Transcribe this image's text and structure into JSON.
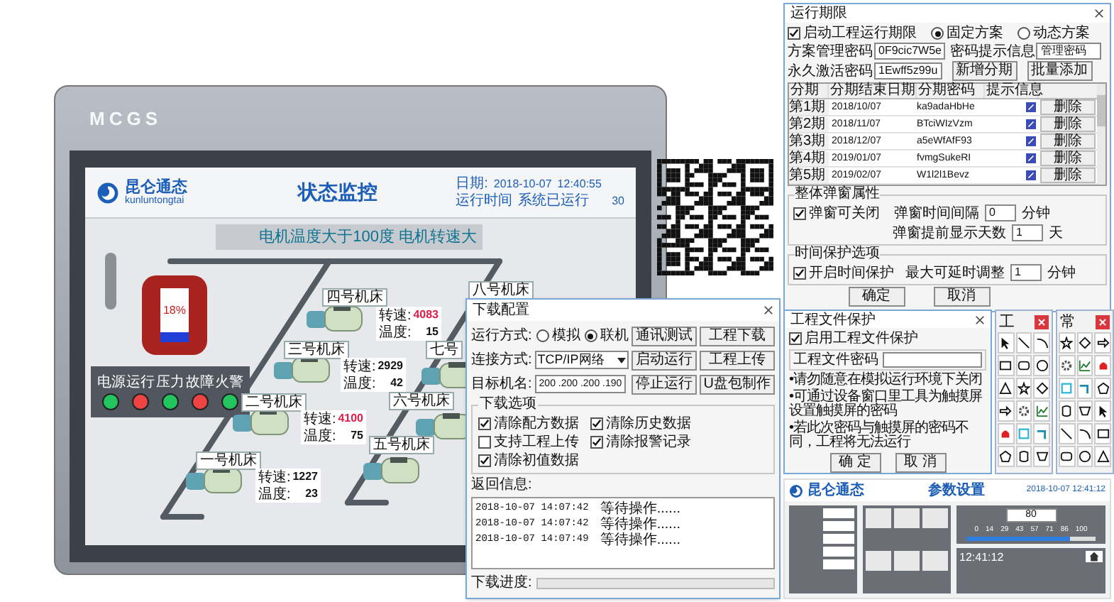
{
  "device": {
    "brand": "MCGS"
  },
  "hmi": {
    "logo": "昆仑通态",
    "logo_sub": "kunluntongtai",
    "title": "状态监控",
    "date_label": "日期:",
    "date": "2018-10-07",
    "time": "12:40:55",
    "runtime_label": "运行时间",
    "runtime_status": "系统已运行",
    "runtime_value": "30",
    "banner": "电机温度大于100度 电机转速大",
    "tank": {
      "reading": "18%",
      "level": 0.18
    },
    "indicators": [
      {
        "label": "电源",
        "color": "#22c55e"
      },
      {
        "label": "运行",
        "color": "#ef4444"
      },
      {
        "label": "压力",
        "color": "#22c55e"
      },
      {
        "label": "故障",
        "color": "#ef4444"
      },
      {
        "label": "火警",
        "color": "#22c55e"
      }
    ],
    "machines": [
      {
        "name": "四号机床",
        "speed_label": "转速:",
        "speed": "4083",
        "alarm": true,
        "temp_label": "温度:",
        "temp": "15"
      },
      {
        "name": "三号机床",
        "speed_label": "转速:",
        "speed": "2929",
        "alarm": false,
        "temp_label": "温度:",
        "temp": "42"
      },
      {
        "name": "二号机床",
        "speed_label": "转速:",
        "speed": "4100",
        "alarm": true,
        "temp_label": "温度:",
        "temp": "75"
      },
      {
        "name": "一号机床",
        "speed_label": "转速:",
        "speed": "1227",
        "alarm": false,
        "temp_label": "温度:",
        "temp": "23"
      },
      {
        "name": "八号机床"
      },
      {
        "name": "七号"
      },
      {
        "name": "六号机床"
      },
      {
        "name": "五号机床"
      }
    ]
  },
  "download_dialog": {
    "title": "下载配置",
    "run_mode_label": "运行方式:",
    "run_modes": [
      {
        "label": "模拟",
        "selected": false
      },
      {
        "label": "联机",
        "selected": true
      }
    ],
    "connection_label": "连接方式:",
    "connection": "TCP/IP网络",
    "target_label": "目标机名:",
    "target": "200 .200 .200 .190",
    "buttons": [
      "通讯测试",
      "工程下载",
      "启动运行",
      "工程上传",
      "停止运行",
      "U盘包制作"
    ],
    "options_title": "下载选项",
    "options": [
      {
        "label": "清除配方数据",
        "checked": true
      },
      {
        "label": "清除历史数据",
        "checked": true
      },
      {
        "label": "支持工程上传",
        "checked": false
      },
      {
        "label": "清除报警记录",
        "checked": true
      },
      {
        "label": "清除初值数据",
        "checked": true
      }
    ],
    "log_label": "返回信息:",
    "log": [
      {
        "time": "2018-10-07 14:07:42",
        "message": "等待操作......"
      },
      {
        "time": "2018-10-07 14:07:42",
        "message": "等待操作......"
      },
      {
        "time": "2018-10-07 14:07:49",
        "message": "等待操作......"
      }
    ],
    "progress_label": "下载进度:",
    "progress": {
      "level": 0
    }
  },
  "period_dialog": {
    "title": "运行期限",
    "enable": {
      "label": "启动工程运行期限",
      "checked": true
    },
    "schemes": [
      {
        "label": "固定方案",
        "selected": true
      },
      {
        "label": "动态方案",
        "selected": false
      }
    ],
    "fields": [
      {
        "label": "方案管理密码",
        "value": "0F9cic7W5e"
      },
      {
        "label": "密码提示信息",
        "value": "管理密码"
      },
      {
        "label": "永久激活密码",
        "value": "1Ewff5z99u"
      }
    ],
    "buttons": [
      "新增分期",
      "批量添加"
    ],
    "columns": [
      "分期",
      "分期结束日期",
      "分期密码",
      "提示信息"
    ],
    "rows": [
      {
        "period": "第1期",
        "date": "2018/10/07",
        "password": "ka9adaHbHe",
        "action": "删除"
      },
      {
        "period": "第2期",
        "date": "2018/11/07",
        "password": "BTciWIzVzm",
        "action": "删除"
      },
      {
        "period": "第3期",
        "date": "2018/12/07",
        "password": "a5eWfAfF93",
        "action": "删除"
      },
      {
        "period": "第4期",
        "date": "2019/01/07",
        "password": "fvmgSukeRI",
        "action": "删除"
      },
      {
        "period": "第5期",
        "date": "2019/02/07",
        "password": "W1l2l1Bevz",
        "action": "删除"
      }
    ],
    "popup_group": {
      "title": "整体弹窗属性",
      "closable": {
        "label": "弹窗可关闭",
        "checked": true
      },
      "interval_label": "弹窗时间间隔",
      "interval": "0",
      "interval_unit": "分钟",
      "advance_label": "弹窗提前显示天数",
      "advance": "1",
      "advance_unit": "天"
    },
    "protect_group": {
      "title": "时间保护选项",
      "enable": {
        "label": "开启时间保护",
        "checked": true
      },
      "max_label": "最大可延时调整",
      "max": "1",
      "max_unit": "分钟"
    },
    "ok": "确定",
    "cancel": "取消"
  },
  "toolbox": [
    {
      "title": "工"
    },
    {
      "title": "常"
    }
  ],
  "protect_dialog": {
    "title": "工程文件保护",
    "enable": {
      "label": "启用工程文件保护",
      "checked": true
    },
    "password_label": "工程文件密码",
    "notes": [
      "•请勿随意在模拟运行环境下关闭",
      "•可通过设备窗口里工具为触摸屏设置触摸屏的密码",
      "•若此次密码与触摸屏的密码不同，工程将无法运行"
    ],
    "ok": "确 定",
    "cancel": "取 消"
  },
  "param_screen": {
    "logo": "昆仑通态",
    "title": "参数设置",
    "date": "2018-10-07 12:41:12",
    "value": "80",
    "scale": [
      "0",
      "14",
      "29",
      "43",
      "57",
      "71",
      "86",
      "100"
    ],
    "slider": {
      "level": 0.8
    },
    "clock": "12:41:12"
  }
}
